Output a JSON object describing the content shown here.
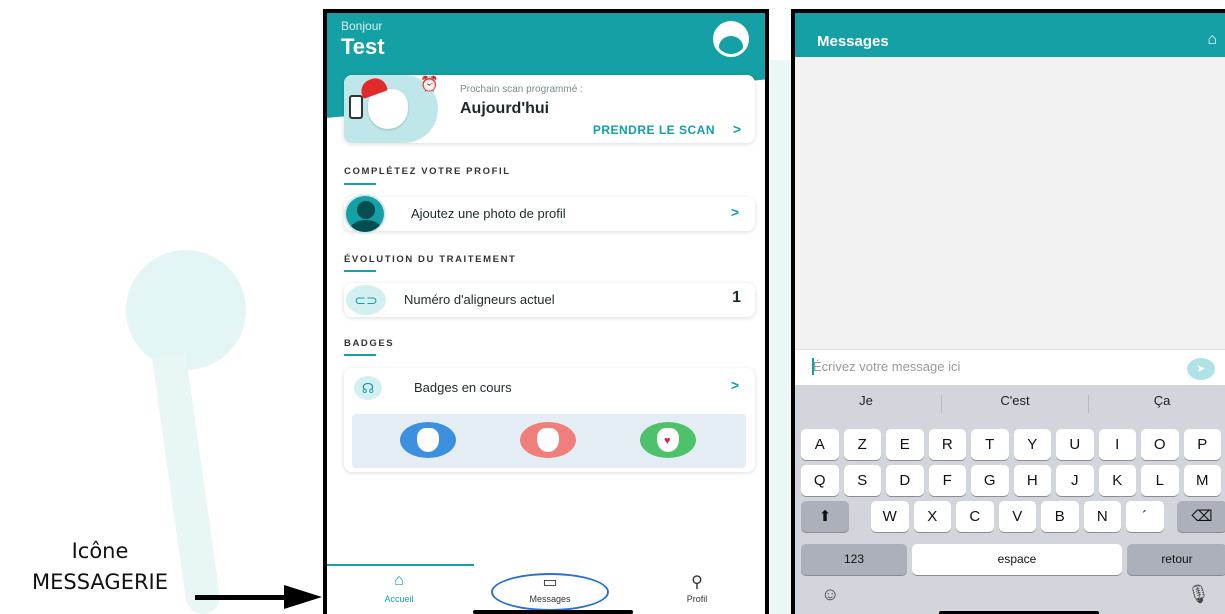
{
  "annotation": {
    "line1": "Icône",
    "line2": "MESSAGERIE"
  },
  "home_screen": {
    "greeting": "Bonjour",
    "user_name": "Test",
    "scan_card": {
      "subtitle": "Prochain scan programmé :",
      "when": "Aujourd'hui",
      "link": "PRENDRE LE SCAN",
      "chevron": ">"
    },
    "profile_section": {
      "title": "COMPLÉTEZ VOTRE PROFIL",
      "row_label": "Ajoutez une photo de profil",
      "chevron": ">"
    },
    "treatment_section": {
      "title": "ÉVOLUTION DU TRAITEMENT",
      "row_label": "Numéro d'aligneurs actuel",
      "value": "1"
    },
    "badges_section": {
      "title": "BADGES",
      "row_label": "Badges en cours",
      "chevron": ">",
      "badges": [
        {
          "color": "#3d8fe0"
        },
        {
          "color": "#f07f7c"
        },
        {
          "color": "#4ec26a"
        }
      ]
    },
    "tabbar": [
      {
        "label": "Accueil",
        "icon": "home-icon",
        "glyph": "⌂",
        "active": true
      },
      {
        "label": "Messages",
        "icon": "message-icon",
        "glyph": "▭",
        "active": false
      },
      {
        "label": "Profil",
        "icon": "person-icon",
        "glyph": "⚲",
        "active": false
      }
    ]
  },
  "messages_screen": {
    "title": "Messages",
    "compose_placeholder": "Écrivez votre message ici",
    "suggestions": [
      "Je",
      "C'est",
      "Ça"
    ],
    "keyboard": {
      "row1": [
        "A",
        "Z",
        "E",
        "R",
        "T",
        "Y",
        "U",
        "I",
        "O",
        "P"
      ],
      "row2": [
        "Q",
        "S",
        "D",
        "F",
        "G",
        "H",
        "J",
        "K",
        "L",
        "M"
      ],
      "row3": [
        "W",
        "X",
        "C",
        "V",
        "B",
        "N",
        "´"
      ],
      "numbers": "123",
      "space": "espace",
      "return": "retour"
    }
  },
  "colors": {
    "accent": "#14a0a5",
    "highlight_oval": "#2b6fd6"
  }
}
